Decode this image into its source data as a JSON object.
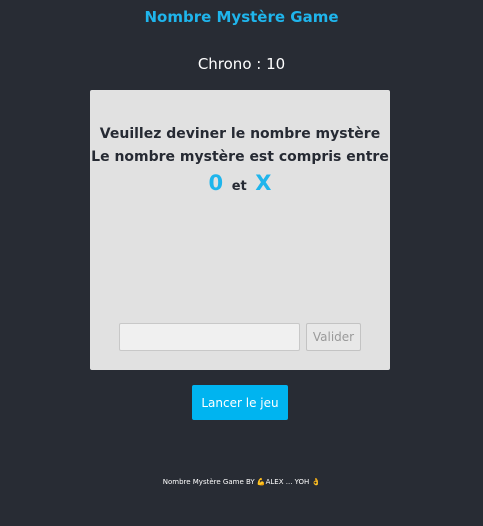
{
  "header": {
    "title": "Nombre Mystère Game"
  },
  "timer": {
    "label": "Chrono : 10"
  },
  "card": {
    "line1": "Veuillez deviner le nombre mystère",
    "line2": "Le nombre mystère est compris entre",
    "min": "0",
    "connector": "et",
    "max": "X"
  },
  "form": {
    "input_value": "",
    "input_placeholder": "",
    "validate_label": "Valider"
  },
  "actions": {
    "start_label": "Lancer le jeu"
  },
  "footer": {
    "text": "Nombre Mystère Game BY 💪ALEX ... YOH 👌"
  },
  "colors": {
    "background": "#282c34",
    "accent": "#1fb5ec",
    "button": "#00b4f0",
    "card": "#e1e1e1"
  }
}
